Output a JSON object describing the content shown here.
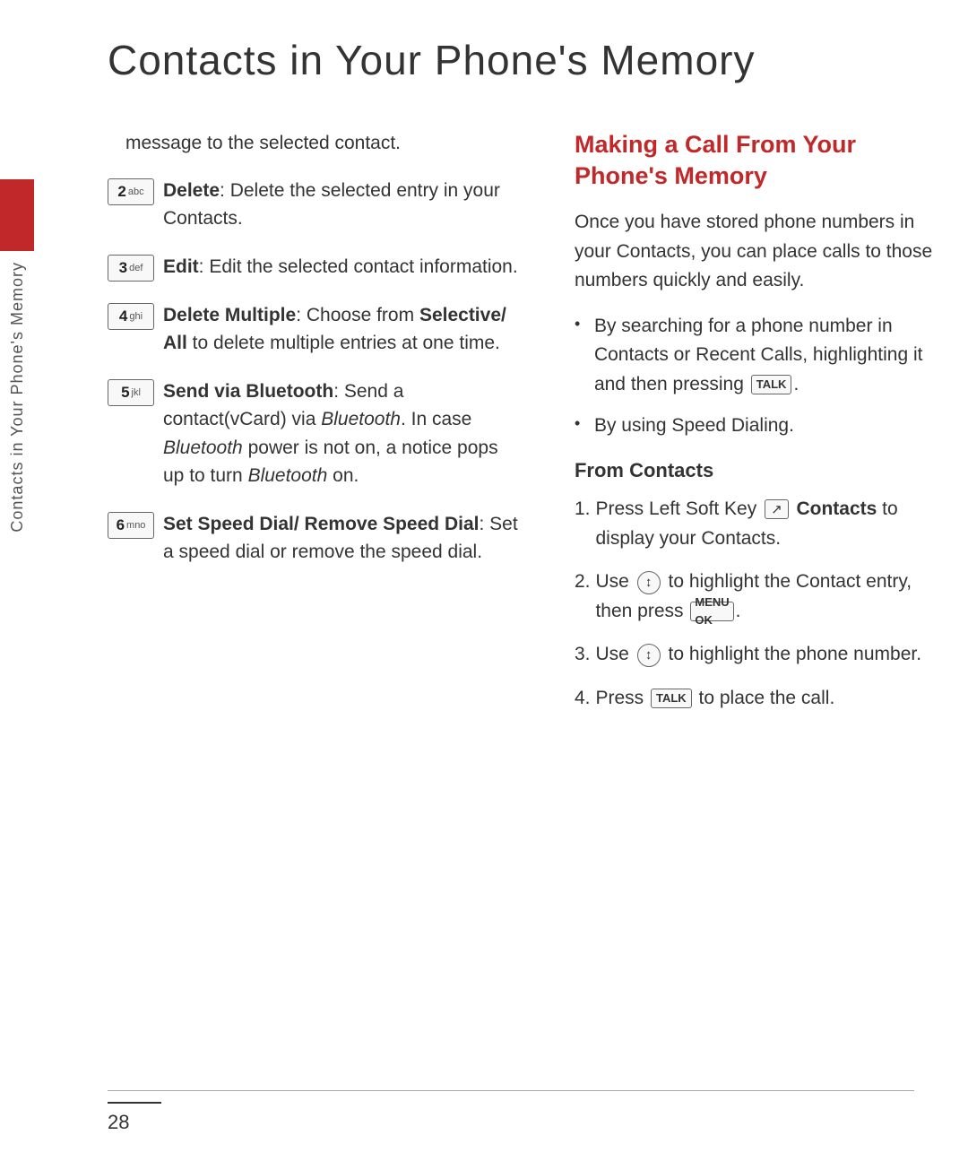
{
  "page": {
    "title": "Contacts in Your Phone's Memory",
    "page_number": "28"
  },
  "side_tab": {
    "label": "Contacts in Your Phone's Memory"
  },
  "left_col": {
    "intro": "message to the selected contact.",
    "menu_items": [
      {
        "key": "2",
        "key_sup": "abc",
        "label_bold": "Delete",
        "label_rest": ": Delete the selected entry in your Contacts."
      },
      {
        "key": "3",
        "key_sup": "def",
        "label_bold": "Edit",
        "label_rest": ": Edit the selected contact information."
      },
      {
        "key": "4",
        "key_sup": "ghi",
        "label_bold": "Delete Multiple",
        "label_rest": ": Choose from Selective/ All to delete multiple entries at one time."
      },
      {
        "key": "5",
        "key_sup": "jkl",
        "label_bold": "Send via Bluetooth",
        "label_rest": ": Send a contact(vCard) via Bluetooth. In case Bluetooth power is not on, a notice pops up to turn Bluetooth on."
      },
      {
        "key": "6",
        "key_sup": "mno",
        "label_bold": "Set Speed Dial/ Remove Speed Dial",
        "label_rest": ": Set a speed dial or remove the speed dial."
      }
    ]
  },
  "right_col": {
    "section_title": "Making a Call From Your Phone's Memory",
    "intro_text": "Once you have stored phone numbers in your Contacts, you can place calls to those numbers quickly and easily.",
    "bullets": [
      "By searching for a phone number in Contacts or Recent Calls, highlighting it and then pressing TALK.",
      "By using Speed Dialing."
    ],
    "from_contacts_title": "From Contacts",
    "steps": [
      "Press Left Soft Key Contacts to display your Contacts.",
      "Use nav to highlight the Contact entry, then press MENU/OK.",
      "Use nav to highlight the phone number.",
      "Press TALK to place the call."
    ]
  }
}
